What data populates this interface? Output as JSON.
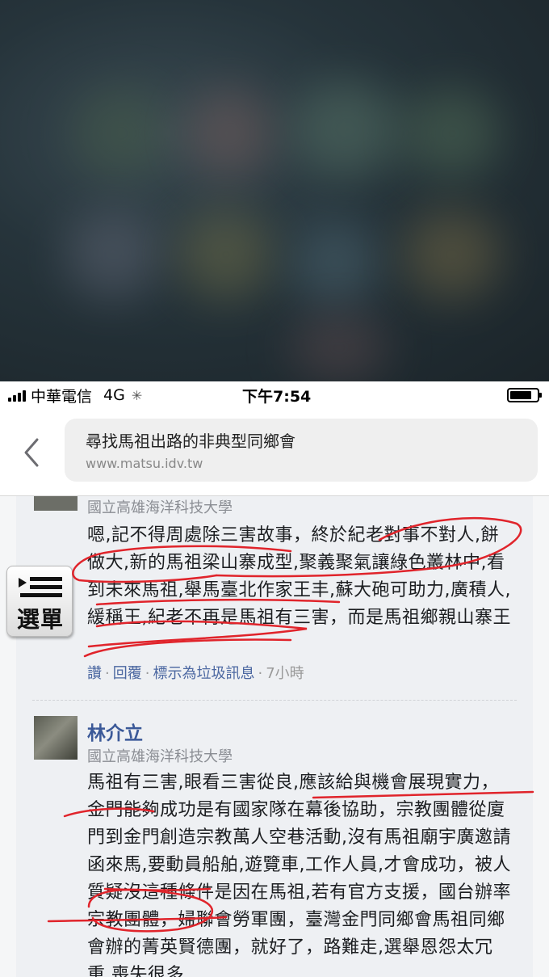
{
  "status_bar": {
    "carrier": "中華電信",
    "network": "4G",
    "time": "下午7:54",
    "battery_level": 0.8
  },
  "browser": {
    "page_title": "尋找馬祖出路的非典型同鄉會",
    "host": "www.matsu.idv.tw"
  },
  "comments": [
    {
      "affiliation": "國立高雄海洋科技大學",
      "text": "嗯,記不得周處除三害故事，終於紀老對事不對人,餅做大,新的馬祖梁山寨成型,聚義聚氣讓綠色叢林中,看到未來馬祖,舉馬臺北作家王丰,蘇大砲可助力,廣積人,緩稱王,紀老不再是馬祖有三害，而是馬祖鄉親山寨王",
      "actions": {
        "read": "讚",
        "reply": "回覆",
        "spam": "標示為垃圾訊息",
        "time": "7小時"
      }
    },
    {
      "name": "林介立",
      "affiliation": "國立高雄海洋科技大學",
      "text": "馬祖有三害,眼看三害從良,應該給與機會展現實力，金門能夠成功是有國家隊在幕後協助，宗教團體從廈門到金門創造宗教萬人空巷活動,沒有馬祖廟宇廣邀請函來馬,要動員船舶,遊覽車,工作人員,才會成功，被人質疑沒這種條件是因在馬祖,若有官方支援，國台辦率宗教團體，婦聯會勞軍團，臺灣金門同鄉會馬祖同鄉會辦的菁英賢德團，就好了，路難走,選舉恩怨太冗重,喪失很多"
    }
  ],
  "menu_button": {
    "label": "選單",
    "icon": "list-menu-icon"
  },
  "colors": {
    "link": "#3b5998",
    "annotation": "#e0242b"
  }
}
